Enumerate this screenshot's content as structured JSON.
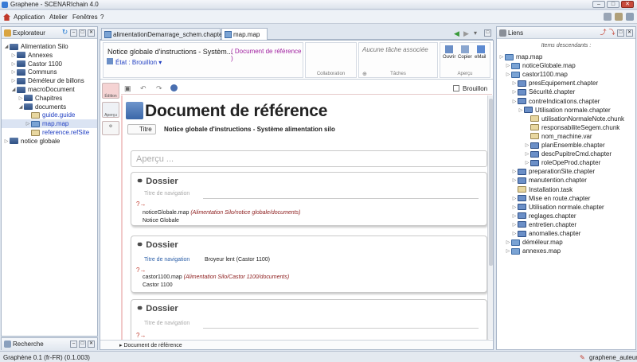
{
  "window": {
    "title": "Graphene - SCENARIchain 4.0"
  },
  "menu": [
    "Application",
    "Atelier",
    "Fenêtres",
    "?"
  ],
  "explorer": {
    "title": "Explorateur",
    "items": [
      {
        "label": "Alimentation Silo",
        "depth": 0,
        "type": "folder",
        "open": true
      },
      {
        "label": "Annexes",
        "depth": 1,
        "type": "folder"
      },
      {
        "label": "Castor 1100",
        "depth": 1,
        "type": "folder"
      },
      {
        "label": "Communs",
        "depth": 1,
        "type": "folder"
      },
      {
        "label": "Déméleur de billons",
        "depth": 1,
        "type": "folder"
      },
      {
        "label": "macroDocument",
        "depth": 1,
        "type": "folder",
        "open": true
      },
      {
        "label": "Chapitres",
        "depth": 2,
        "type": "folder"
      },
      {
        "label": "documents",
        "depth": 2,
        "type": "folder",
        "open": true
      },
      {
        "label": "guide.guide",
        "depth": 3,
        "type": "file",
        "link": true
      },
      {
        "label": "map.map",
        "depth": 3,
        "type": "map",
        "link": true,
        "selected": true
      },
      {
        "label": "reference.refSite",
        "depth": 3,
        "type": "file",
        "link": true
      },
      {
        "label": "notice globale",
        "depth": 0,
        "type": "folder"
      }
    ]
  },
  "search": {
    "title": "Recherche"
  },
  "tabs": [
    {
      "label": "alimentationDemarrage_schem.chapter",
      "active": false
    },
    {
      "label": "map.map",
      "active": true
    }
  ],
  "ribbon": {
    "doc_title": "Notice globale d'instructions - Systèm...",
    "doc_ref": "Document de référence",
    "state_label": "État : Brouillon",
    "collab_label": "Collaboration",
    "task_placeholder": "Aucune tâche associée",
    "tasks_label": "Tâches",
    "actions": [
      "Ouvrir",
      "Copier",
      "eMail"
    ],
    "apercu_label": "Aperçu"
  },
  "toolbar": {
    "brouillon": "Brouillon"
  },
  "side_tools": [
    "Édition",
    "Aperçu"
  ],
  "document": {
    "heading": "Document de référence",
    "titre_tag": "Titre",
    "titre_value": "Notice globale d'instructions - Système alimentation silo",
    "apercu_placeholder": "Aperçu ...",
    "sections": [
      {
        "heading": "Dossier",
        "nav_label": "Titre de navigation",
        "nav_value": "",
        "ref": "noticeGlobale.map",
        "path": "(Alimentation Silo/notice globale/documents)",
        "sub": "Notice Globale"
      },
      {
        "heading": "Dossier",
        "nav_label": "Titre de navigation",
        "nav_value": "Broyeur lent (Castor 1100)",
        "ref": "castor1100.map",
        "path": "(Alimentation Silo/Castor 1100/documents)",
        "sub": "Castor 1100"
      },
      {
        "heading": "Dossier",
        "nav_label": "Titre de navigation",
        "nav_value": "",
        "ref": "",
        "path": "",
        "sub": ""
      }
    ],
    "breadcrumb": "Document de référence"
  },
  "links": {
    "title": "Liens",
    "subtitle": "Items descendants :",
    "items": [
      {
        "label": "map.map",
        "depth": 0,
        "icon": "map"
      },
      {
        "label": "noticeGlobale.map",
        "depth": 1,
        "icon": "map"
      },
      {
        "label": "castor1100.map",
        "depth": 1,
        "icon": "map"
      },
      {
        "label": "presEquipement.chapter",
        "depth": 2,
        "icon": "chap"
      },
      {
        "label": "Sécurité.chapter",
        "depth": 2,
        "icon": "chap"
      },
      {
        "label": "contreIndications.chapter",
        "depth": 2,
        "icon": "chap"
      },
      {
        "label": "Utilisation normale.chapter",
        "depth": 3,
        "icon": "chap"
      },
      {
        "label": "utilisationNormaleNote.chunk",
        "depth": 4,
        "icon": "file"
      },
      {
        "label": "responsabiliteSegem.chunk",
        "depth": 4,
        "icon": "file"
      },
      {
        "label": "nom_machine.var",
        "depth": 4,
        "icon": "var"
      },
      {
        "label": "planEnsemble.chapter",
        "depth": 4,
        "icon": "chap"
      },
      {
        "label": "descPupitreCmd.chapter",
        "depth": 4,
        "icon": "chap"
      },
      {
        "label": "roleOpeProd.chapter",
        "depth": 4,
        "icon": "chap"
      },
      {
        "label": "preparationSite.chapter",
        "depth": 2,
        "icon": "chap"
      },
      {
        "label": "manutention.chapter",
        "depth": 2,
        "icon": "chap"
      },
      {
        "label": "Installation.task",
        "depth": 2,
        "icon": "file"
      },
      {
        "label": "Mise en route.chapter",
        "depth": 2,
        "icon": "chap"
      },
      {
        "label": "Utilisation normale.chapter",
        "depth": 2,
        "icon": "chap"
      },
      {
        "label": "reglages.chapter",
        "depth": 2,
        "icon": "chap"
      },
      {
        "label": "entretien.chapter",
        "depth": 2,
        "icon": "chap"
      },
      {
        "label": "anomalies.chapter",
        "depth": 2,
        "icon": "chap"
      },
      {
        "label": "déméleur.map",
        "depth": 1,
        "icon": "map"
      },
      {
        "label": "annexes.map",
        "depth": 1,
        "icon": "map"
      }
    ]
  },
  "status": {
    "left": "Graphène 0.1 (fr-FR) (0.1.003)",
    "user": "graphene_auteur"
  }
}
